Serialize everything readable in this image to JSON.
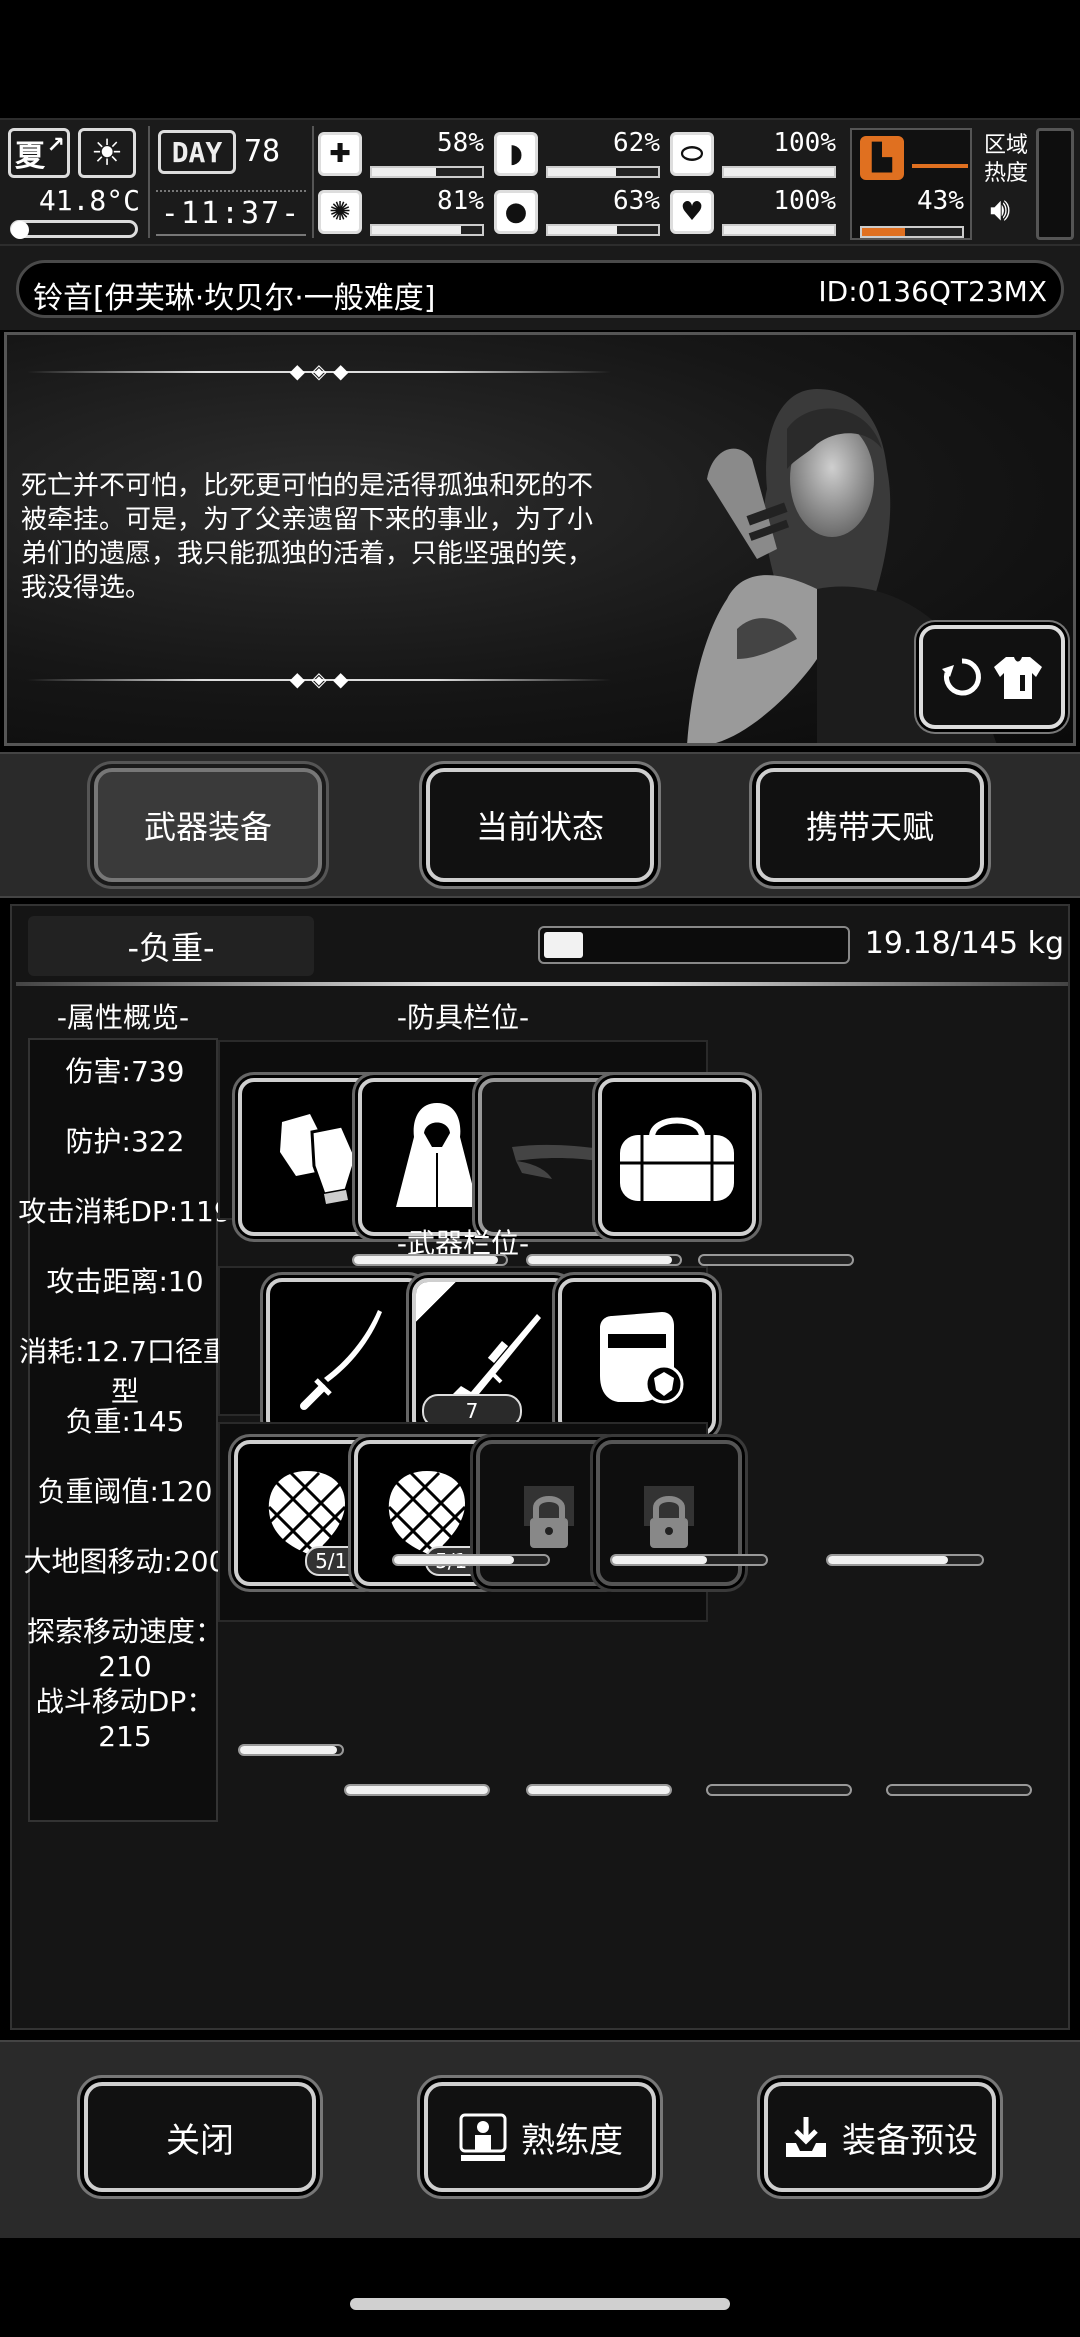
{
  "status": {
    "season": "夏",
    "weather_icon": "sun-icon",
    "temperature": "41.8°C",
    "day_label": "DAY",
    "day_number": "78",
    "clock": "-11:37-",
    "stats": [
      {
        "name": "health",
        "icon": "medkit-icon",
        "glyph": "✚",
        "value": "58%",
        "fill": 0.58
      },
      {
        "name": "hunger",
        "icon": "stomach-icon",
        "glyph": "◗",
        "value": "62%",
        "fill": 0.62
      },
      {
        "name": "stamina",
        "icon": "pill-icon",
        "glyph": "⬭",
        "value": "100%",
        "fill": 1.0
      },
      {
        "name": "sanity",
        "icon": "brain-icon",
        "glyph": "✺",
        "value": "81%",
        "fill": 0.81
      },
      {
        "name": "thirst",
        "icon": "water-drop-icon",
        "glyph": "💧",
        "value": "63%",
        "fill": 0.63
      },
      {
        "name": "mood",
        "icon": "heart-icon",
        "glyph": "♥",
        "value": "100%",
        "fill": 1.0
      }
    ],
    "fatigue": {
      "icon": "boot-icon",
      "value": "43%",
      "fill": 0.43,
      "color": "#e07020"
    },
    "region_label": "区域热度"
  },
  "character": {
    "name": "铃音[伊芙琳·坎贝尔·一般难度]",
    "id": "ID:0136QT23MX",
    "quote": "死亡并不可怕，比死更可怕的是活得孤独和死的不被牵挂。可是，为了父亲遗留下来的事业，为了小弟们的遗愿，我只能孤独的活着，只能坚强的笑，我没得选。"
  },
  "tabs": [
    "武器装备",
    "当前状态",
    "携带天赋"
  ],
  "load": {
    "label": "-负重-",
    "value": "19.18/145 kg",
    "fill": 0.13
  },
  "attributes": {
    "title": "-属性概览-",
    "items": [
      "伤害:739",
      "防护:322",
      "攻击消耗DP:119",
      "攻击距离:10",
      "消耗:12.7口径重型",
      "负重:145",
      "负重阈值:120",
      "大地图移动:200",
      "探索移动速度：210",
      "战斗移动DP：215"
    ]
  },
  "armor": {
    "title": "-防具栏位-",
    "slots": [
      {
        "icon": "gloves-icon",
        "durability": 0.95
      },
      {
        "icon": "cloak-icon",
        "durability": 0.95
      },
      {
        "icon": "visor-cap-icon",
        "durability": 0.0,
        "empty": true
      },
      {
        "icon": "duffel-bag-icon",
        "durability": null
      }
    ]
  },
  "weapons": {
    "title": "-武器栏位-",
    "slots": [
      {
        "icon": "katana-icon",
        "durability": 0.78
      },
      {
        "icon": "sniper-rifle-icon",
        "durability": 0.62,
        "ammo": "7"
      },
      {
        "icon": "riot-shield-icon",
        "durability": 0.78
      }
    ]
  },
  "consumables": {
    "slots": [
      {
        "icon": "net-icon",
        "count": "5/10",
        "durability": 1.0
      },
      {
        "icon": "net-icon",
        "count": "5/10",
        "durability": 1.0
      },
      {
        "icon": "locked-slot-icon",
        "locked": true
      },
      {
        "icon": "locked-slot-icon",
        "locked": true
      }
    ]
  },
  "bottom": {
    "close": "关闭",
    "proficiency": "熟练度",
    "preset": "装备预设"
  }
}
